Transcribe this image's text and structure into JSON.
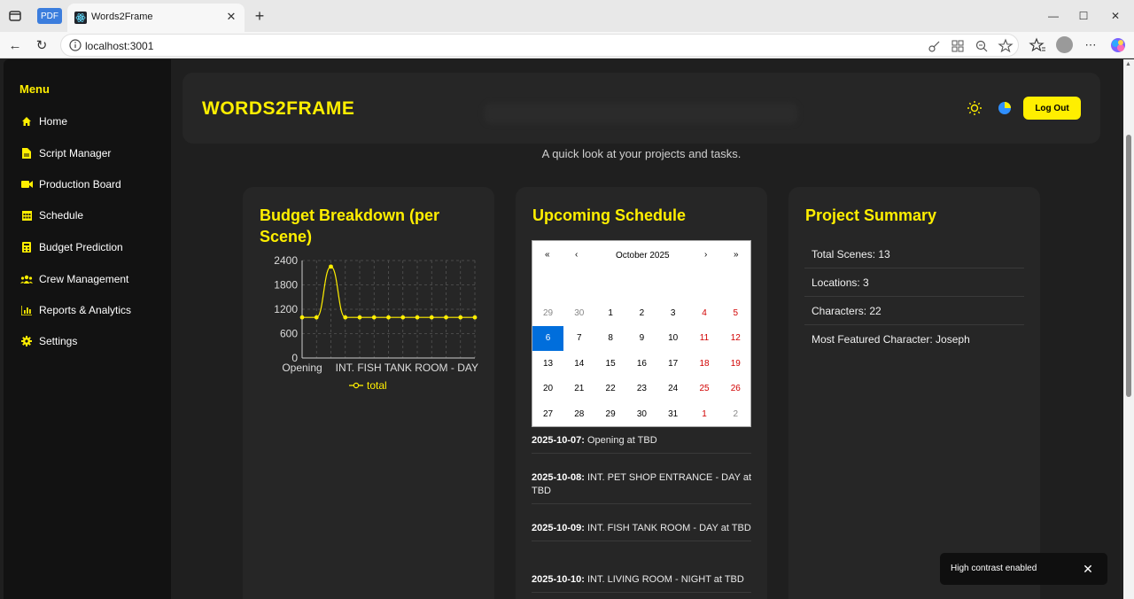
{
  "browser": {
    "pdf_tab_label": "PDF",
    "tab_title": "Words2Frame",
    "tab_close": "✕",
    "new_tab": "+",
    "minimize": "—",
    "maximize": "☐",
    "close": "✕",
    "back": "←",
    "reload": "↻",
    "url": "localhost:3001"
  },
  "sidebar": {
    "title": "Menu",
    "items": [
      {
        "label": "Home",
        "icon": "home-icon"
      },
      {
        "label": "Script Manager",
        "icon": "file-icon"
      },
      {
        "label": "Production Board",
        "icon": "video-icon"
      },
      {
        "label": "Schedule",
        "icon": "calendar-icon"
      },
      {
        "label": "Budget Prediction",
        "icon": "budget-icon"
      },
      {
        "label": "Crew Management",
        "icon": "users-icon"
      },
      {
        "label": "Reports & Analytics",
        "icon": "chart-icon"
      },
      {
        "label": "Settings",
        "icon": "gear-icon"
      }
    ]
  },
  "header": {
    "brand": "WORDS2FRAME",
    "logout_label": "Log Out"
  },
  "subtitle": "A quick look at your projects and tasks.",
  "budget": {
    "title": "Budget Breakdown (per Scene)"
  },
  "chart_data": {
    "type": "line",
    "title": "Budget Breakdown (per Scene)",
    "x_tick_labels": [
      "Opening",
      "INT. FISH TANK ROOM - DAY"
    ],
    "y_ticks": [
      0,
      600,
      1200,
      1800,
      2400
    ],
    "ylim": [
      0,
      2400
    ],
    "grid": true,
    "legend": "bottom",
    "series": [
      {
        "name": "total",
        "values": [
          1000,
          1000,
          2250,
          1000,
          1000,
          1000,
          1000,
          1000,
          1000,
          1000,
          1000,
          1000,
          1000
        ]
      }
    ],
    "color": "#ffef00"
  },
  "schedule": {
    "title": "Upcoming Schedule",
    "calendar": {
      "month_label": "October 2025",
      "prev2": "«",
      "prev": "‹",
      "next": "›",
      "next2": "»",
      "weeks": [
        [
          {
            "d": "29",
            "c": "#888888"
          },
          {
            "d": "30",
            "c": "#888888"
          },
          {
            "d": "1",
            "c": "#000000"
          },
          {
            "d": "2",
            "c": "#000000"
          },
          {
            "d": "3",
            "c": "#000000"
          },
          {
            "d": "4",
            "c": "#d10000"
          },
          {
            "d": "5",
            "c": "#d10000"
          }
        ],
        [
          {
            "d": "6",
            "c": "#ffffff",
            "sel": true
          },
          {
            "d": "7",
            "c": "#000000"
          },
          {
            "d": "8",
            "c": "#000000"
          },
          {
            "d": "9",
            "c": "#000000"
          },
          {
            "d": "10",
            "c": "#000000"
          },
          {
            "d": "11",
            "c": "#d10000"
          },
          {
            "d": "12",
            "c": "#d10000"
          }
        ],
        [
          {
            "d": "13",
            "c": "#000000"
          },
          {
            "d": "14",
            "c": "#000000"
          },
          {
            "d": "15",
            "c": "#000000"
          },
          {
            "d": "16",
            "c": "#000000"
          },
          {
            "d": "17",
            "c": "#000000"
          },
          {
            "d": "18",
            "c": "#d10000"
          },
          {
            "d": "19",
            "c": "#d10000"
          }
        ],
        [
          {
            "d": "20",
            "c": "#000000"
          },
          {
            "d": "21",
            "c": "#000000"
          },
          {
            "d": "22",
            "c": "#000000"
          },
          {
            "d": "23",
            "c": "#000000"
          },
          {
            "d": "24",
            "c": "#000000"
          },
          {
            "d": "25",
            "c": "#d10000"
          },
          {
            "d": "26",
            "c": "#d10000"
          }
        ],
        [
          {
            "d": "27",
            "c": "#000000"
          },
          {
            "d": "28",
            "c": "#000000"
          },
          {
            "d": "29",
            "c": "#000000"
          },
          {
            "d": "30",
            "c": "#000000"
          },
          {
            "d": "31",
            "c": "#000000"
          },
          {
            "d": "1",
            "c": "#d10000"
          },
          {
            "d": "2",
            "c": "#888888"
          }
        ]
      ]
    },
    "items": [
      {
        "date": "2025-10-07:",
        "text": " Opening at TBD"
      },
      {
        "date": "2025-10-08:",
        "text": " INT. PET SHOP ENTRANCE - DAY at TBD"
      },
      {
        "date": "2025-10-09:",
        "text": " INT. FISH TANK ROOM - DAY at TBD"
      },
      {
        "date": "2025-10-10:",
        "text": " INT. LIVING ROOM - NIGHT at TBD"
      }
    ]
  },
  "summary": {
    "title": "Project Summary",
    "rows": [
      "Total Scenes: 13",
      "Locations: 3",
      "Characters: 22",
      "Most Featured Character: Joseph"
    ]
  },
  "toast": {
    "text": "High contrast enabled",
    "close": "✕"
  }
}
